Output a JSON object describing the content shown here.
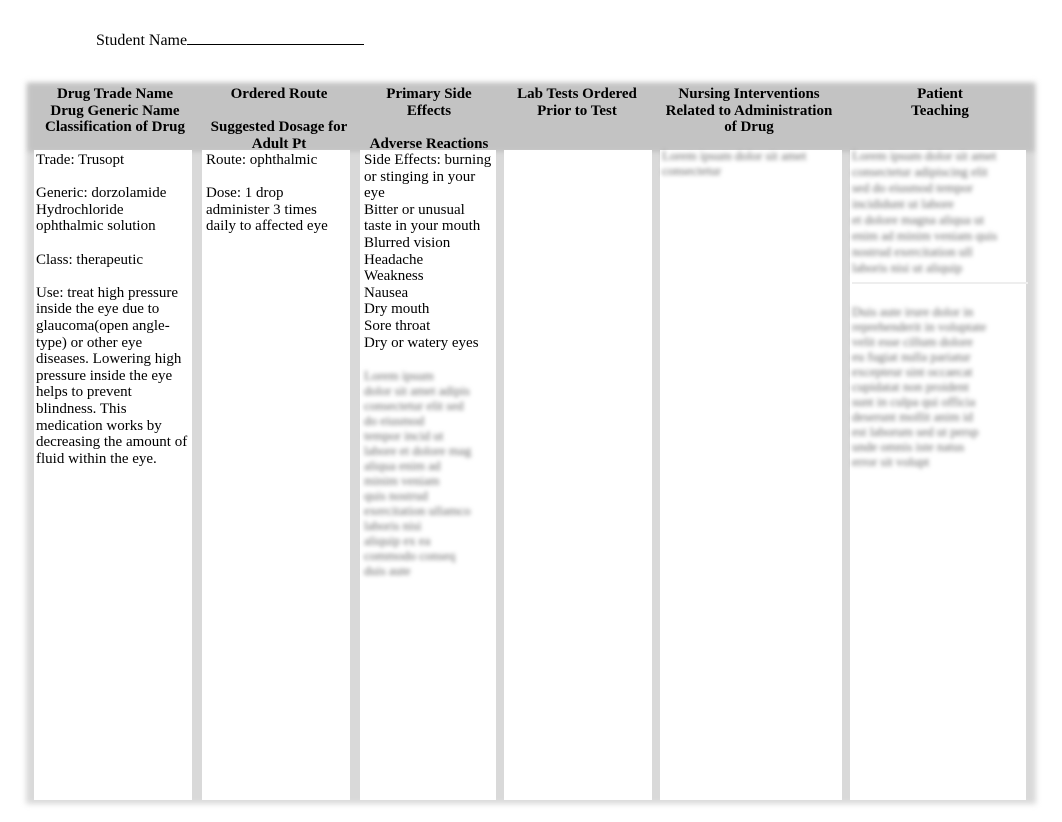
{
  "student_label": "Student Name",
  "headers": {
    "col1": [
      "Drug Trade Name",
      "Drug Generic Name",
      "Classification of Drug"
    ],
    "col2_top": "Ordered Route",
    "col2_bottom": [
      "Suggested Dosage for",
      "Adult Pt"
    ],
    "col3_top": [
      "Primary Side",
      "Effects"
    ],
    "col3_bottom": "Adverse Reactions",
    "col4": [
      "Lab Tests Ordered",
      "Prior to Test"
    ],
    "col5": [
      "Nursing Interventions",
      "Related to Administration",
      "of Drug"
    ],
    "col6": [
      "Patient",
      "Teaching"
    ]
  },
  "col1": {
    "trade": "Trade: Trusopt",
    "generic": [
      "Generic: dorzolamide",
      "Hydrochloride",
      "ophthalmic solution"
    ],
    "class": "Class: therapeutic",
    "use": [
      "Use: treat high pressure",
      "inside the eye due to",
      "glaucoma(open angle-",
      "type) or other eye",
      "diseases. Lowering high",
      "pressure inside the eye",
      "helps to prevent",
      "blindness. This",
      "medication works by",
      "decreasing the amount of",
      "fluid within the eye."
    ]
  },
  "col2": {
    "route": "Route: ophthalmic",
    "dose": [
      "Dose: 1 drop",
      "administer 3 times",
      "daily to affected eye"
    ]
  },
  "col3": {
    "side_effects": [
      "Side Effects: burning",
      "or stinging in your",
      "eye",
      "Bitter or unusual",
      "taste in your mouth",
      "Blurred vision",
      "Headache",
      "Weakness",
      "Nausea",
      "Dry mouth",
      "Sore throat",
      "Dry or watery eyes"
    ],
    "adverse_blurred": [
      "Lorem ipsum",
      "dolor sit amet adipis",
      "consectetur elit sed",
      "do eiusmod",
      "tempor incid ut",
      "labore et dolore mag",
      "aliqua enim ad",
      "minim veniam",
      "quis nostrud",
      "exercitation ullamco",
      "laboris nisi",
      "aliquip ex ea",
      "commodo conseq",
      "duis aute"
    ]
  },
  "col5": {
    "blurred": [
      "Lorem ipsum dolor sit amet",
      "consectetur"
    ]
  },
  "col6": {
    "blurred_a": [
      "Lorem ipsum dolor sit amet",
      "consectetur adipiscing elit",
      "sed do eiusmod tempor",
      "incididunt ut labore",
      "et dolore magna aliqua ut",
      "enim ad minim veniam quis",
      "nostrud exercitation ull",
      "laboris nisi ut aliquip"
    ],
    "blurred_b": [
      "Duis aute irure dolor in",
      "reprehenderit in voluptate",
      "velit esse cillum dolore",
      "eu fugiat nulla pariatur",
      "excepteur sint occaecat",
      "cupidatat non proident",
      "sunt in culpa qui officia",
      "deserunt mollit anim id",
      "est laborum sed ut persp",
      "unde omnis iste natus",
      "error sit volupt"
    ]
  }
}
